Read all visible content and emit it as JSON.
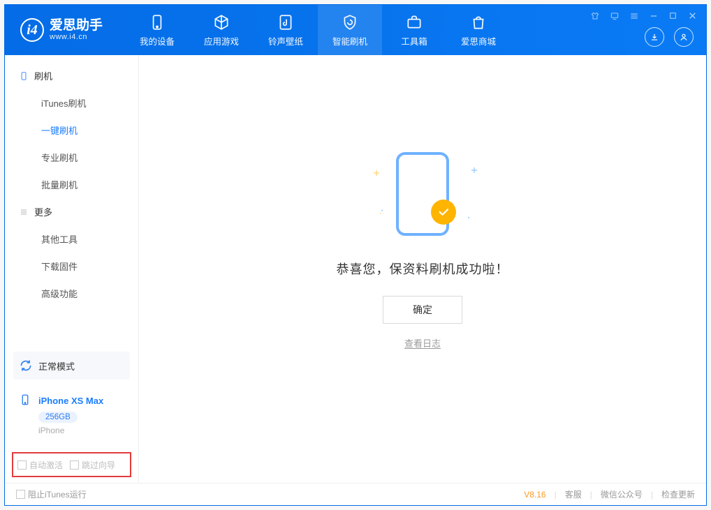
{
  "app": {
    "title": "爱思助手",
    "subtitle": "www.i4.cn"
  },
  "tabs": {
    "device": "我的设备",
    "apps": "应用游戏",
    "ringtone": "铃声壁纸",
    "flash": "智能刷机",
    "toolbox": "工具箱",
    "store": "爱思商城"
  },
  "sidebar": {
    "group_flash": "刷机",
    "items": {
      "itunes": "iTunes刷机",
      "oneclick": "一键刷机",
      "pro": "专业刷机",
      "batch": "批量刷机"
    },
    "group_more": "更多",
    "more": {
      "other": "其他工具",
      "firmware": "下载固件",
      "advanced": "高级功能"
    }
  },
  "device": {
    "mode": "正常模式",
    "name": "iPhone XS Max",
    "capacity": "256GB",
    "type": "iPhone"
  },
  "options": {
    "auto_activate": "自动激活",
    "skip_guide": "跳过向导"
  },
  "main": {
    "message": "恭喜您，保资料刷机成功啦！",
    "ok": "确定",
    "view_log": "查看日志"
  },
  "footer": {
    "block_itunes": "阻止iTunes运行",
    "version": "V8.16",
    "support": "客服",
    "wechat": "微信公众号",
    "update": "检查更新"
  }
}
